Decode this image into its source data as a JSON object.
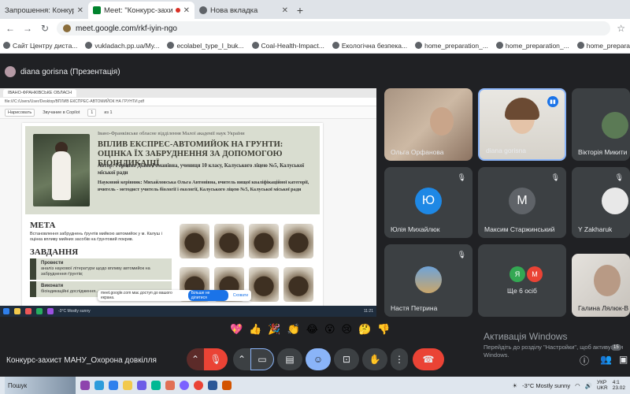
{
  "browser": {
    "tabs": [
      {
        "title": "Запрошення: Конкурс-захист МА",
        "close": "✕"
      },
      {
        "title": "Meet: \"Конкурс-захист МА...",
        "close": "✕"
      },
      {
        "title": "Нова вкладка",
        "close": "✕"
      }
    ],
    "new_tab": "+",
    "url": "meet.google.com/rkf-iyin-ngo",
    "bookmarks": [
      "Сайт Центру диста...",
      "vukladach.pp.ua/My...",
      "ecolabel_type_I_buk...",
      "Coal-Health-Impact...",
      "Екологічна безпека...",
      "home_preparation_...",
      "home_preparation_...",
      "home_preparation_..."
    ]
  },
  "meet": {
    "presenter_label": "diana gorisna (Презентація)",
    "meeting_name": "Конкурс-захист МАНУ_Охорона довкілля",
    "more_count_label": "Ще 6 осіб",
    "more_avatars": [
      "Я",
      "М"
    ],
    "participants": [
      {
        "name": "Ольга Орфанова"
      },
      {
        "name": "diana gorisna"
      },
      {
        "name": "Вікторія Микити"
      },
      {
        "name": "Юлія Михайлюк",
        "initial": "Ю"
      },
      {
        "name": "Максим Старжинський",
        "initial": "М"
      },
      {
        "name": "Y Zakharuk"
      },
      {
        "name": "Настя Петрина"
      },
      {
        "name": "Галина Лялюк-В"
      }
    ],
    "reactions": [
      "💖",
      "👍",
      "🎉",
      "👏",
      "😂",
      "😮",
      "😢",
      "🤔",
      "👎"
    ],
    "badge": "15"
  },
  "presentation": {
    "tab": "ІВАНО-ФРАНКІВСЬКЕ ОБЛАСН",
    "addr": "file:///C:/Users/User/Desktop/ВПЛИВ ЕКСПРЕС-АВТОМИЙОК НА ГРУНТИ.pdf",
    "tools": [
      "Нарисовать",
      "Звучание в Copilot",
      "1",
      "из 1"
    ],
    "org": "Івано-Франківське обласне відділення Малої академії наук України",
    "title": "ВПЛИВ ЕКСПРЕС-АВТОМИЙОК НА ГРУНТИ: ОЦІНКА ЇХ ЗАБРУДНЕННЯ ЗА ДОПОМОГОЮ БІОІНДИКАЦІЇ",
    "author": "Автор: Горішна Діана Романівна, учениця 10 класу, Калуського ліцею №5, Калуської міської ради",
    "supervisor": "Науковий керівник: Михайловська Ольга Антонівна, вчитель вищої кваліфікаційної категорії, вчитель - методист учитель біології і екології, Калуського ліцею №5, Калуської міської ради",
    "meta_h": "МЕТА",
    "meta_text": "Встановлення забруднень ґрунтів мийкою автомийок у м. Калуш і оцінка впливу мийних засобів на ґрунтовий покрив.",
    "tasks_h": "ЗАВДАННЯ",
    "task1_h": "Провести",
    "task1_t": "аналіз наукової літератури щодо впливу автомийок на забруднення ґрунтів;",
    "task2_h": "Виконати",
    "task2_t": "біоіндикаційні дослідження...",
    "notice_text": "meet.google.com має доступ до вашого екрана.",
    "notice_stop": "Більше не ділитися",
    "notice_hide": "Сховати",
    "taskbar_weather": "-3°C  Mostly sunny",
    "taskbar_time": "11:21"
  },
  "windows": {
    "activation_title": "Активація Windows",
    "activation_text": "Перейдіть до розділу \"Настройки\", щоб активувати Windows.",
    "taskbar_search": "Пошук",
    "weather": "-3°C  Mostly sunny",
    "lang": "УКР",
    "lang2": "UKR",
    "time": "4:1",
    "date": "23.02"
  }
}
